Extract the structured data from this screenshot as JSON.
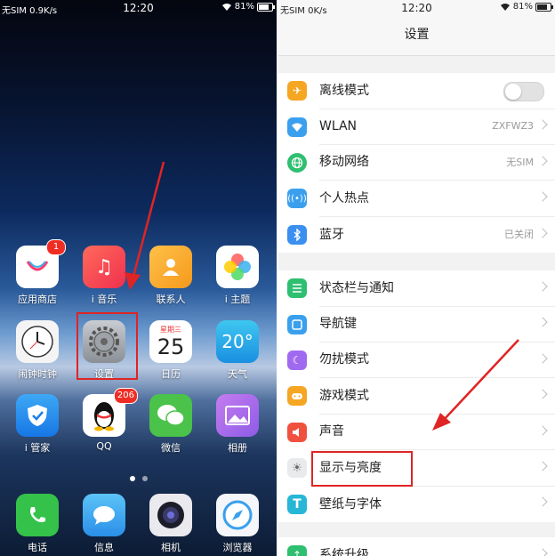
{
  "left_status": {
    "carrier": "无SIM 0.9K/s",
    "time": "12:20",
    "battery": "81%"
  },
  "right_status": {
    "carrier": "无SIM 0K/s",
    "time": "12:20",
    "battery": "81%"
  },
  "battery_level": 0.81,
  "home": {
    "apps": [
      {
        "label": "应用商店",
        "icon": "app-store-icon",
        "badge": "1"
      },
      {
        "label": "i 音乐",
        "icon": "music-note-icon"
      },
      {
        "label": "联系人",
        "icon": "contacts-icon"
      },
      {
        "label": "i 主题",
        "icon": "theme-petals-icon"
      },
      {
        "label": "闹钟时钟",
        "icon": "clock-icon"
      },
      {
        "label": "设置",
        "icon": "gear-icon"
      },
      {
        "label": "日历",
        "icon": "calendar-icon",
        "weekday": "星期三",
        "day": "25"
      },
      {
        "label": "天气",
        "icon": "weather-icon",
        "temp": "20°"
      },
      {
        "label": "i 管家",
        "icon": "shield-icon"
      },
      {
        "label": "QQ",
        "icon": "qq-penguin-icon",
        "badge": "206"
      },
      {
        "label": "微信",
        "icon": "wechat-icon"
      },
      {
        "label": "相册",
        "icon": "gallery-icon"
      }
    ],
    "dock": [
      {
        "label": "电话",
        "icon": "phone-icon"
      },
      {
        "label": "信息",
        "icon": "message-icon"
      },
      {
        "label": "相机",
        "icon": "camera-icon"
      },
      {
        "label": "浏览器",
        "icon": "compass-icon"
      }
    ]
  },
  "settings": {
    "title": "设置",
    "group1": [
      {
        "label": "离线模式",
        "icon": "airplane-icon",
        "color": "#f5a623",
        "toggle": false
      },
      {
        "label": "WLAN",
        "icon": "wifi-icon",
        "color": "#3aa0ee",
        "value": "ZXFWZ3"
      },
      {
        "label": "移动网络",
        "icon": "globe-icon",
        "color": "#2fbf71",
        "value": "无SIM"
      },
      {
        "label": "个人热点",
        "icon": "hotspot-icon",
        "color": "#3aa0ee"
      },
      {
        "label": "蓝牙",
        "icon": "bluetooth-icon",
        "color": "#3a8ff0",
        "value": "已关闭"
      }
    ],
    "group2": [
      {
        "label": "状态栏与通知",
        "icon": "status-bar-icon",
        "color": "#2fbf71"
      },
      {
        "label": "导航键",
        "icon": "nav-keys-icon",
        "color": "#3aa0ee"
      },
      {
        "label": "勿扰模式",
        "icon": "moon-icon",
        "color": "#a06af0"
      },
      {
        "label": "游戏模式",
        "icon": "gamepad-icon",
        "color": "#f5a623"
      },
      {
        "label": "声音",
        "icon": "speaker-icon",
        "color": "#f0513f"
      },
      {
        "label": "显示与亮度",
        "icon": "brightness-icon",
        "color": "#9aa0a6"
      },
      {
        "label": "壁纸与字体",
        "icon": "text-icon",
        "color": "#27b6d6"
      }
    ],
    "group3": [
      {
        "label": "系统升级",
        "icon": "upgrade-icon",
        "color": "#2fbf71"
      }
    ]
  },
  "colors": {
    "annotation": "#e02424"
  }
}
